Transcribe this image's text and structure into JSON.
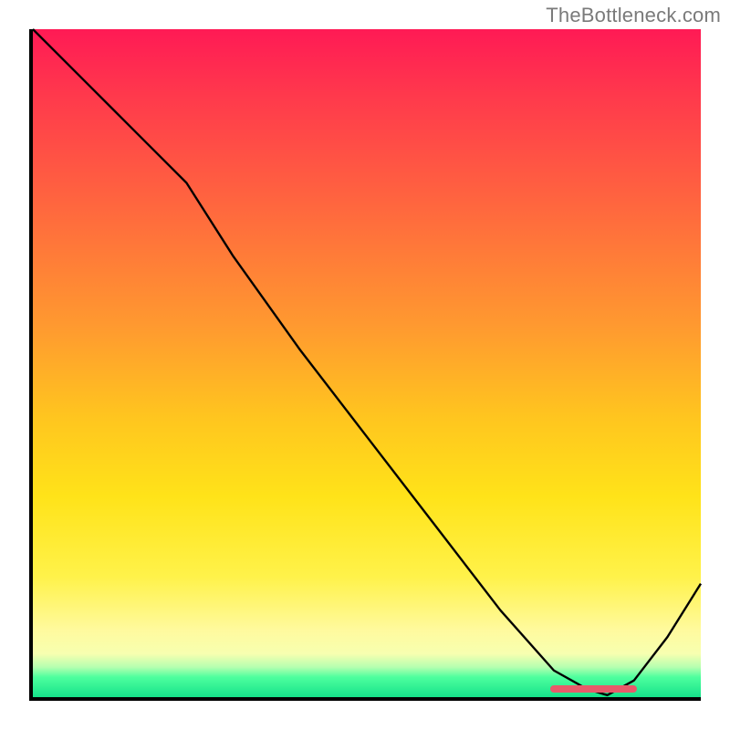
{
  "watermark": "TheBottleneck.com",
  "colors": {
    "axis": "#000000",
    "curve": "#000000",
    "dash": "#e85a6a",
    "gradient_top": "#ff1a55",
    "gradient_bottom": "#15e28a"
  },
  "chart_data": {
    "type": "line",
    "title": "",
    "xlabel": "",
    "ylabel": "",
    "xlim": [
      0,
      100
    ],
    "ylim": [
      0,
      100
    ],
    "grid": false,
    "legend": false,
    "annotations": [
      {
        "kind": "dash",
        "x_start": 77,
        "x_end": 90,
        "y": 0.5,
        "color": "#e85a6a"
      }
    ],
    "series": [
      {
        "name": "curve",
        "x": [
          0,
          8,
          17,
          23,
          30,
          40,
          50,
          60,
          70,
          78,
          83,
          86,
          90,
          95,
          100
        ],
        "values": [
          100,
          92,
          83,
          77,
          66,
          52,
          39,
          26,
          13,
          4,
          1.2,
          0.3,
          2.5,
          9,
          17
        ]
      }
    ]
  }
}
